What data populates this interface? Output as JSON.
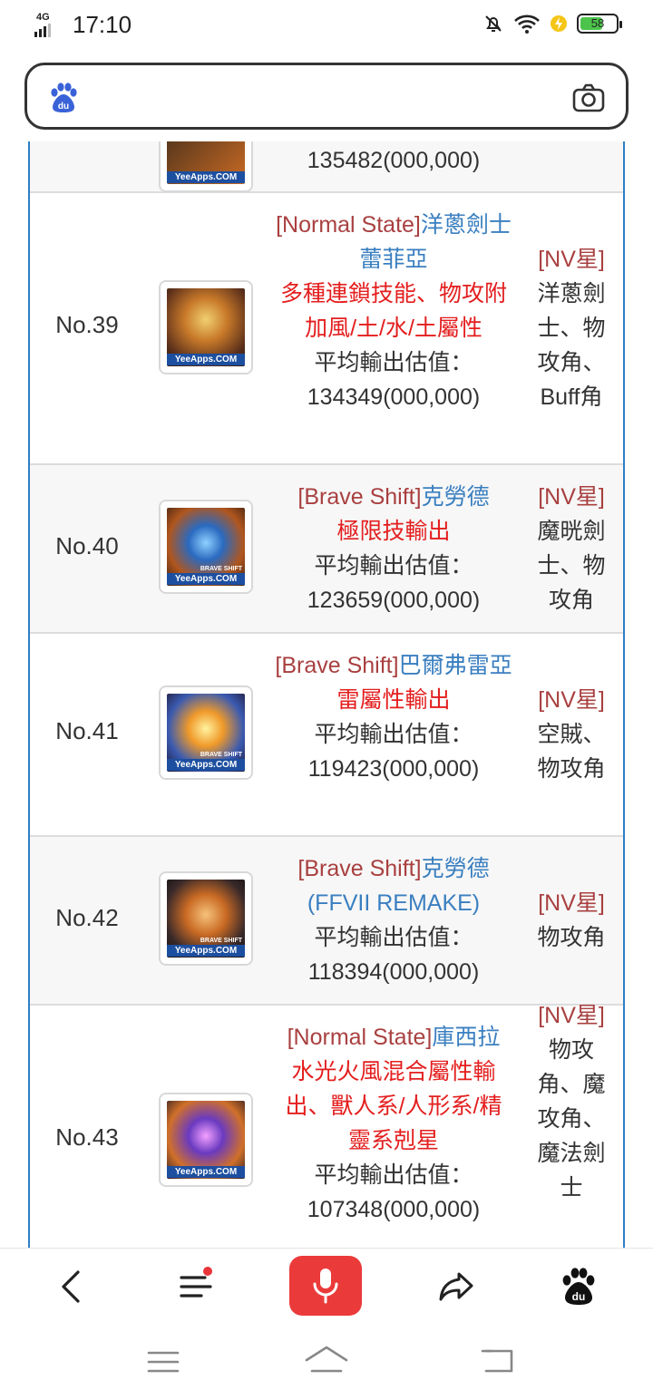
{
  "status_bar": {
    "network": "4G",
    "time": "17:10",
    "battery": "58"
  },
  "search": {
    "logo_text": "du"
  },
  "rows": [
    {
      "value": "135482(000,000)"
    },
    {
      "no": "No.39",
      "state": "[Normal State]",
      "name": "洋蔥劍士蕾菲亞",
      "skill": "多種連鎖技能、物攻附加風/土/水/土屬性",
      "label": "平均輸出估值：",
      "value": "134349(000,000)",
      "star": "[NV星]",
      "role": "洋蔥劍士、物攻角、Buff角"
    },
    {
      "no": "No.40",
      "state": "[Brave Shift]",
      "name": "克勞德",
      "skill": "極限技輸出",
      "label": "平均輸出估值：",
      "value": "123659(000,000)",
      "star": "[NV星]",
      "role": "魔晄劍士、物攻角"
    },
    {
      "no": "No.41",
      "state": "[Brave Shift]",
      "name": "巴爾弗雷亞",
      "skill": "雷屬性輸出",
      "label": "平均輸出估值：",
      "value": "119423(000,000)",
      "star": "[NV星]",
      "role": "空賊、物攻角"
    },
    {
      "no": "No.42",
      "state": "[Brave Shift]",
      "name": "克勞德(FFVII REMAKE)",
      "skill": "",
      "label": "平均輸出估值：",
      "value": "118394(000,000)",
      "star": "[NV星]",
      "role": "物攻角"
    },
    {
      "no": "No.43",
      "state": "[Normal State]",
      "name": "庫西拉",
      "skill": "水光火風混合屬性輸出、獸人系/人形系/精靈系剋星",
      "label": "平均輸出估值：",
      "value": "107348(000,000)",
      "star": "[NV星]",
      "role": "物攻角、魔攻角、魔法劍士"
    }
  ],
  "thumb": {
    "watermark": "YeeApps.COM",
    "brave_badge": "BRAVE SHIFT"
  },
  "icons": {
    "status": [
      "signal-icon",
      "mute-icon",
      "wifi-icon",
      "charging-icon",
      "battery-icon"
    ],
    "search": [
      "baidu-paw-icon",
      "camera-icon"
    ],
    "nav": [
      "back-icon",
      "menu-icon",
      "microphone-icon",
      "share-icon",
      "baidu-home-icon"
    ],
    "system": [
      "recent-apps-icon",
      "home-icon",
      "return-icon"
    ]
  },
  "colors": {
    "accent_blue": "#2e7fc4",
    "state_red": "#a94040",
    "skill_red": "#e41e1e",
    "mic_red": "#eb3a3a"
  }
}
